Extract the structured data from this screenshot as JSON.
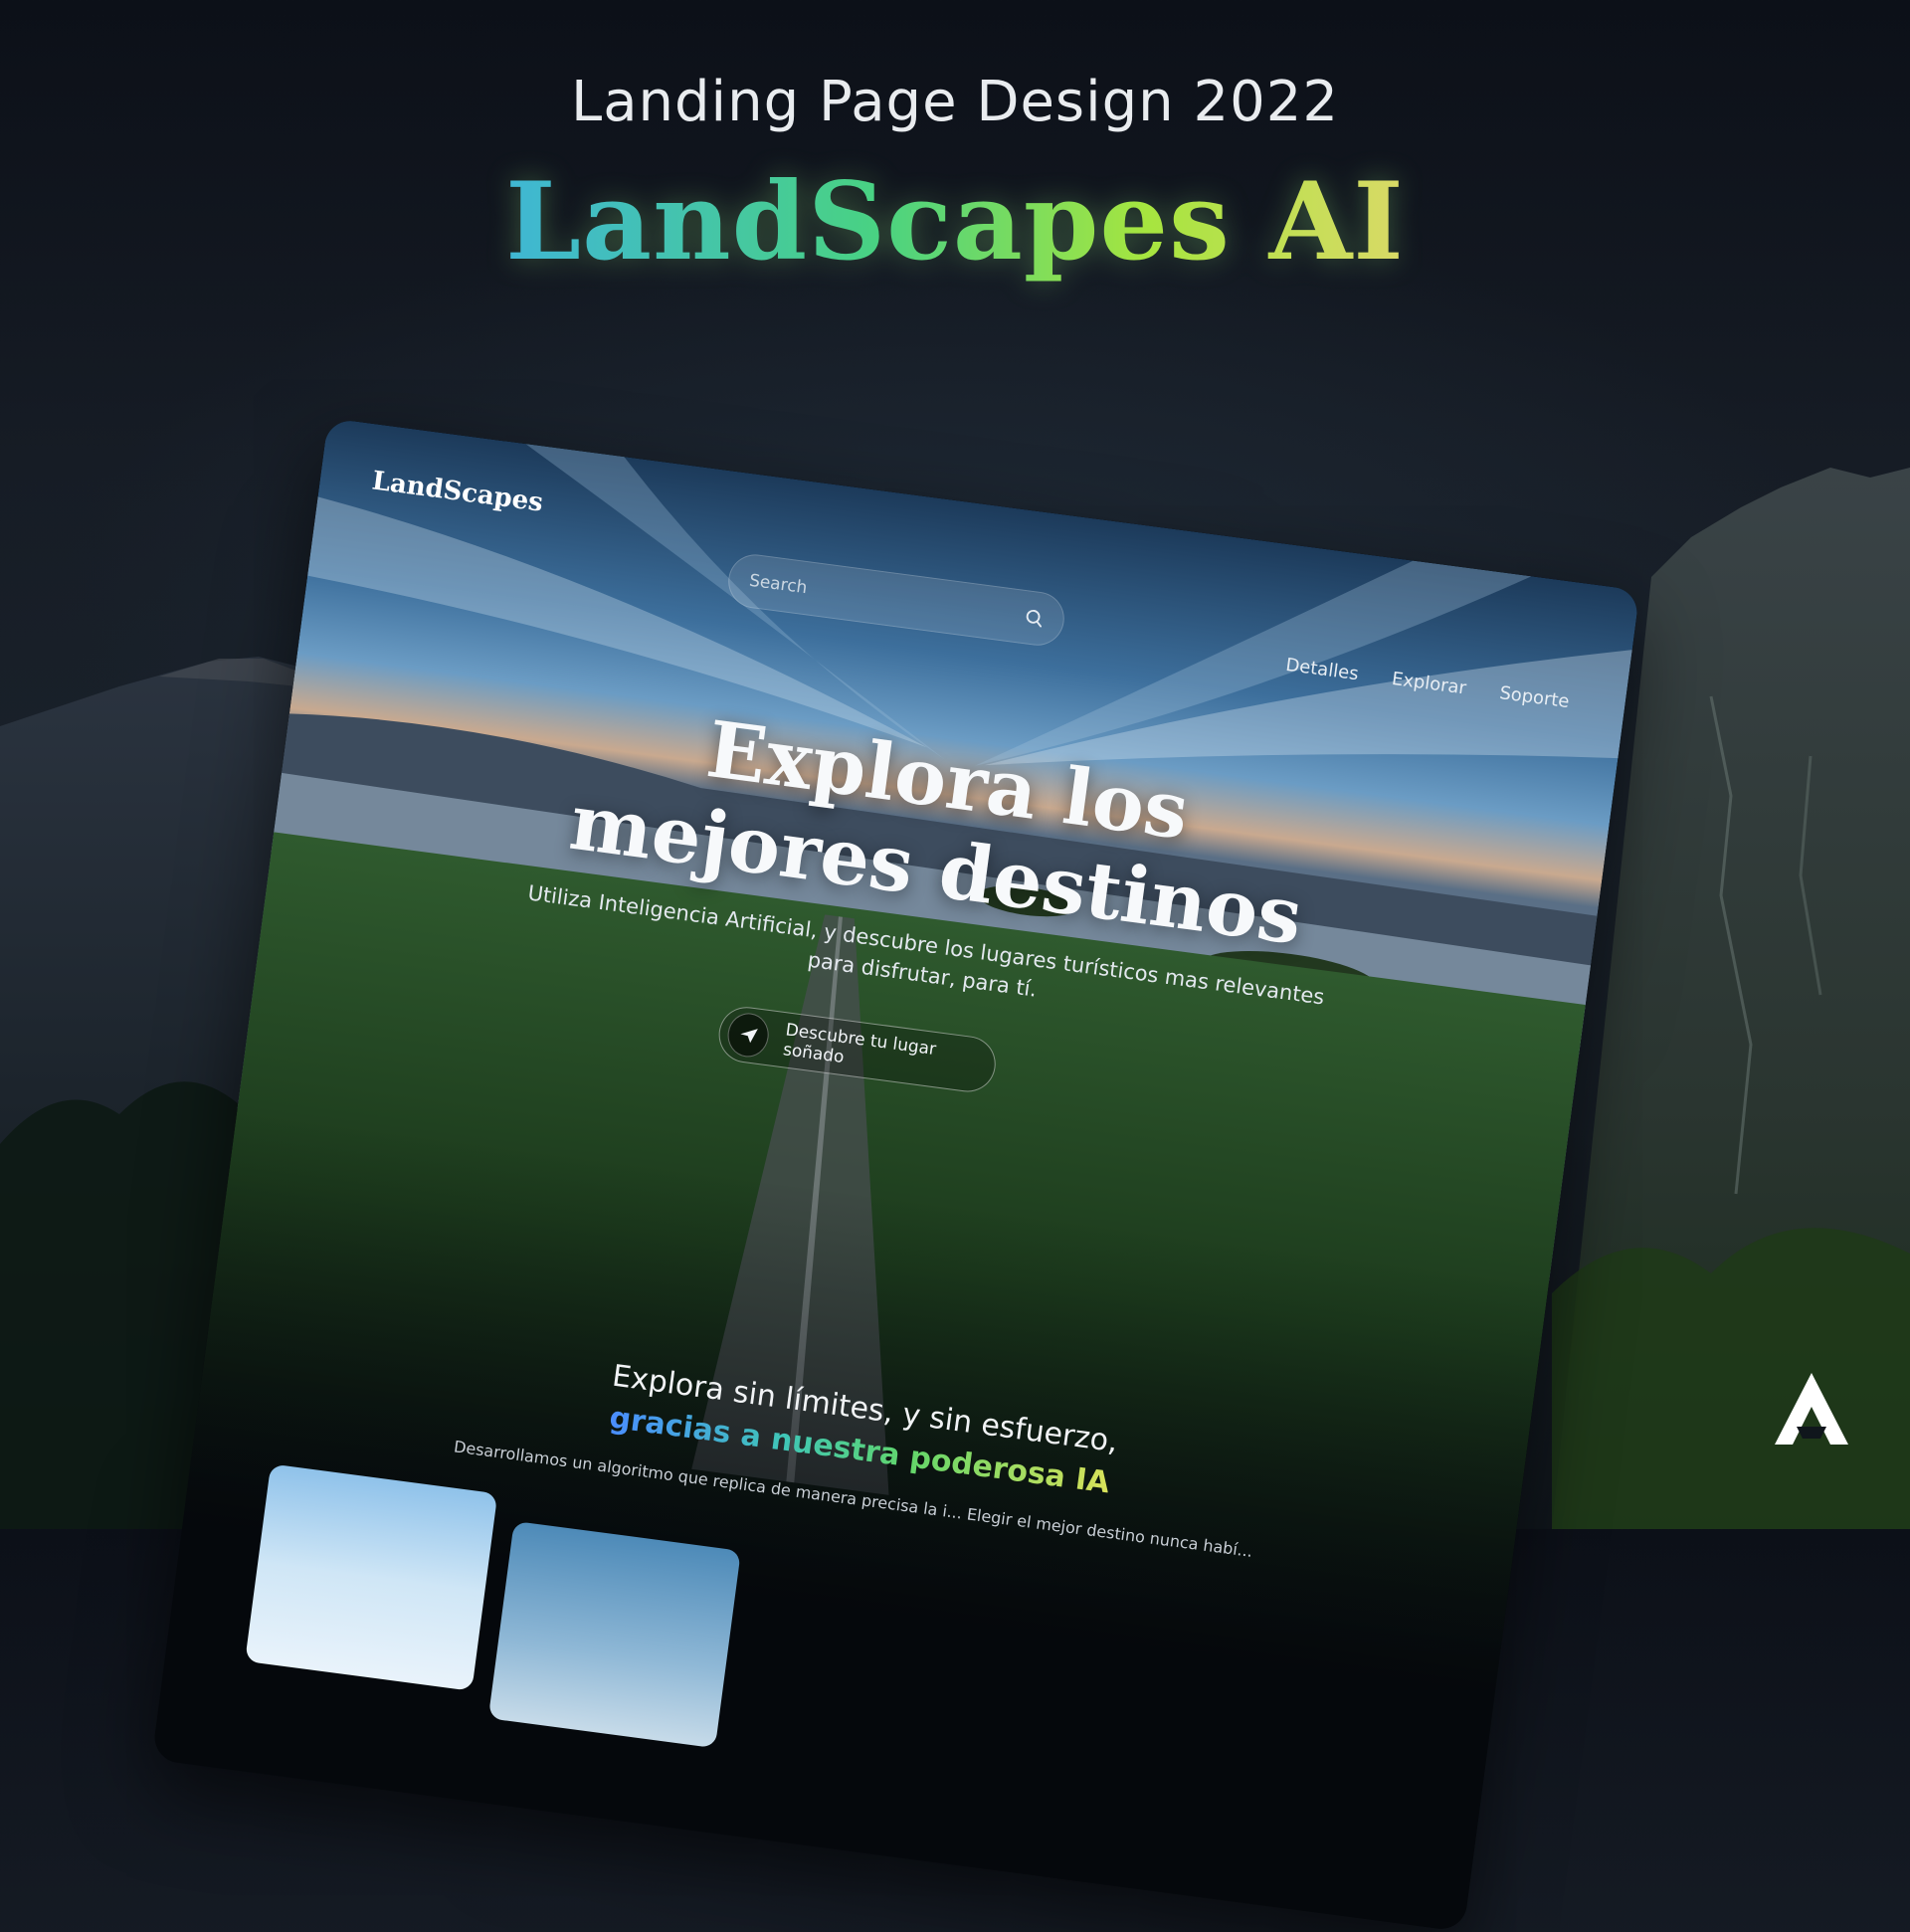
{
  "header": {
    "subtitle": "Landing Page Design 2022",
    "title": "LandScapes AI"
  },
  "mockup": {
    "brand": "LandScapes",
    "search": {
      "placeholder": "Search"
    },
    "nav": [
      "Detalles",
      "Explorar",
      "Soporte"
    ],
    "hero": {
      "title_line1": "Explora los",
      "title_line2": "mejores destinos",
      "description": "Utiliza Inteligencia Artificial, y descubre los lugares turísticos mas relevantes para disfrutar, para tí.",
      "cta_label": "Descubre tu lugar soñado"
    },
    "section": {
      "title": "Explora sin límites, y sin esfuerzo,",
      "accent": "gracias a nuestra poderosa IA",
      "description": "Desarrollamos un algoritmo que replica de manera precisa la i... Elegir el mejor destino nunca habí..."
    }
  },
  "colors": {
    "background": "#10161c",
    "title_gradient": [
      "#4a8dff",
      "#3fb6d6",
      "#49d282",
      "#a6e53f",
      "#f2d47a"
    ]
  }
}
